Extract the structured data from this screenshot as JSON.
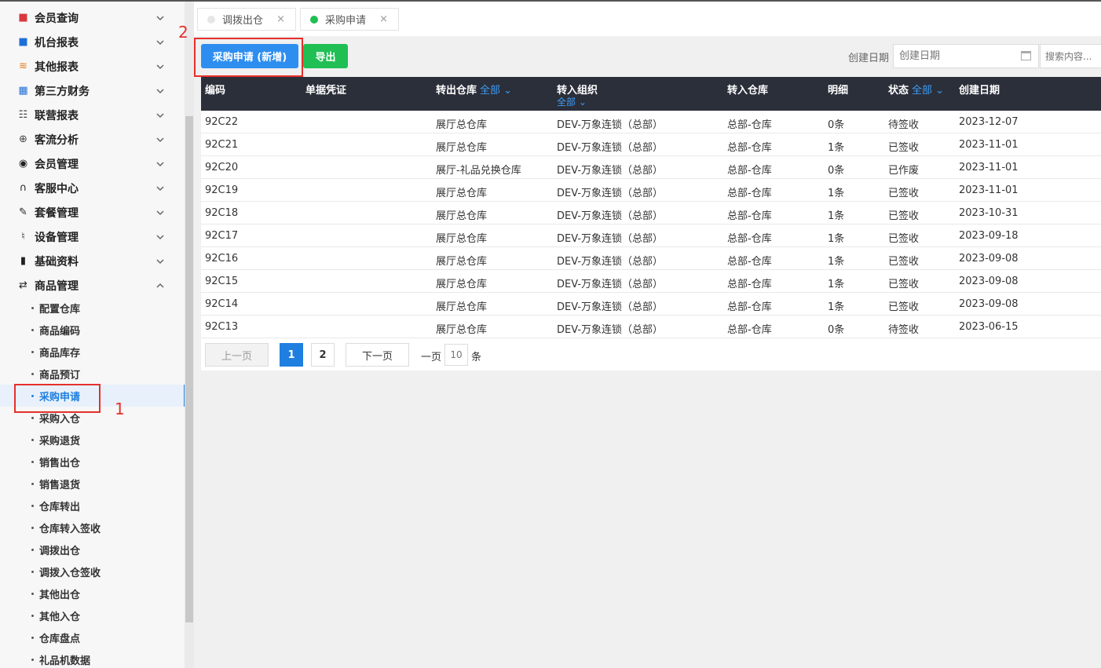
{
  "sidebar": {
    "menu": [
      {
        "label": "会员查询",
        "icon": "book-icon",
        "glyph": "■",
        "color": "#d9363e",
        "expanded": false
      },
      {
        "label": "机台报表",
        "icon": "book-blue-icon",
        "glyph": "■",
        "color": "#1e6fd9",
        "expanded": false
      },
      {
        "label": "其他报表",
        "icon": "layers-icon",
        "glyph": "≋",
        "color": "#e07b1e",
        "expanded": false
      },
      {
        "label": "第三方财务",
        "icon": "calculator-icon",
        "glyph": "▦",
        "color": "#1e6fd9",
        "expanded": false
      },
      {
        "label": "联营报表",
        "icon": "users-icon",
        "glyph": "☷",
        "color": "#444",
        "expanded": false
      },
      {
        "label": "客流分析",
        "icon": "target-icon",
        "glyph": "⊕",
        "color": "#444",
        "expanded": false
      },
      {
        "label": "会员管理",
        "icon": "user-circle-icon",
        "glyph": "◉",
        "color": "#222",
        "expanded": false
      },
      {
        "label": "客服中心",
        "icon": "headset-icon",
        "glyph": "∩",
        "color": "#222",
        "expanded": false
      },
      {
        "label": "套餐管理",
        "icon": "edit-icon",
        "glyph": "✎",
        "color": "#222",
        "expanded": false
      },
      {
        "label": "设备管理",
        "icon": "stethoscope-icon",
        "glyph": "♮",
        "color": "#222",
        "expanded": false
      },
      {
        "label": "基础资料",
        "icon": "file-icon",
        "glyph": "▮",
        "color": "#222",
        "expanded": false
      },
      {
        "label": "商品管理",
        "icon": "transfer-icon",
        "glyph": "⇄",
        "color": "#222",
        "expanded": true
      }
    ],
    "submenu": [
      {
        "label": "配置仓库"
      },
      {
        "label": "商品编码"
      },
      {
        "label": "商品库存"
      },
      {
        "label": "商品预订"
      },
      {
        "label": "采购申请",
        "active": true
      },
      {
        "label": "采购入仓"
      },
      {
        "label": "采购退货"
      },
      {
        "label": "销售出仓"
      },
      {
        "label": "销售退货"
      },
      {
        "label": "仓库转出"
      },
      {
        "label": "仓库转入签收"
      },
      {
        "label": "调拨出仓"
      },
      {
        "label": "调拨入仓签收"
      },
      {
        "label": "其他出仓"
      },
      {
        "label": "其他入仓"
      },
      {
        "label": "仓库盘点"
      },
      {
        "label": "礼品机数据"
      }
    ]
  },
  "tabs": [
    {
      "label": "调拨出仓",
      "dot_color": "#e6e6e6",
      "close": "×"
    },
    {
      "label": "采购申请",
      "dot_color": "#1fbf54",
      "close": "×"
    }
  ],
  "toolbar": {
    "add_label": "采购申请 (新增)",
    "export_label": "导出",
    "date_filter_label": "创建日期",
    "date_placeholder": "创建日期",
    "search_placeholder": "搜索内容..."
  },
  "table": {
    "columns": [
      {
        "label": "编码"
      },
      {
        "label": "单据凭证"
      },
      {
        "label": "转出仓库",
        "filter": "全部 ⌄"
      },
      {
        "label": "转入组织",
        "filter2": "全部 ⌄"
      },
      {
        "label": "转入仓库"
      },
      {
        "label": "明细"
      },
      {
        "label": "状态",
        "filter": "全部 ⌄"
      },
      {
        "label": "创建日期"
      }
    ],
    "rows": [
      [
        "92C22",
        "",
        "展厅总仓库",
        "DEV-万象连锁（总部）",
        "总部-仓库",
        "0条",
        "待签收",
        "2023-12-07"
      ],
      [
        "92C21",
        "",
        "展厅总仓库",
        "DEV-万象连锁（总部）",
        "总部-仓库",
        "1条",
        "已签收",
        "2023-11-01"
      ],
      [
        "92C20",
        "",
        "展厅-礼品兑换仓库",
        "DEV-万象连锁（总部）",
        "总部-仓库",
        "0条",
        "已作废",
        "2023-11-01"
      ],
      [
        "92C19",
        "",
        "展厅总仓库",
        "DEV-万象连锁（总部）",
        "总部-仓库",
        "1条",
        "已签收",
        "2023-11-01"
      ],
      [
        "92C18",
        "",
        "展厅总仓库",
        "DEV-万象连锁（总部）",
        "总部-仓库",
        "1条",
        "已签收",
        "2023-10-31"
      ],
      [
        "92C17",
        "",
        "展厅总仓库",
        "DEV-万象连锁（总部）",
        "总部-仓库",
        "1条",
        "已签收",
        "2023-09-18"
      ],
      [
        "92C16",
        "",
        "展厅总仓库",
        "DEV-万象连锁（总部）",
        "总部-仓库",
        "1条",
        "已签收",
        "2023-09-08"
      ],
      [
        "92C15",
        "",
        "展厅总仓库",
        "DEV-万象连锁（总部）",
        "总部-仓库",
        "1条",
        "已签收",
        "2023-09-08"
      ],
      [
        "92C14",
        "",
        "展厅总仓库",
        "DEV-万象连锁（总部）",
        "总部-仓库",
        "1条",
        "已签收",
        "2023-09-08"
      ],
      [
        "92C13",
        "",
        "展厅总仓库",
        "DEV-万象连锁（总部）",
        "总部-仓库",
        "0条",
        "待签收",
        "2023-06-15"
      ]
    ]
  },
  "pagination": {
    "prev": "上一页",
    "pages": [
      "1",
      "2"
    ],
    "current": "1",
    "next": "下一页",
    "per_page_prefix": "一页",
    "per_page_value": "10",
    "per_page_suffix": "条"
  },
  "annotations": {
    "marker1": "1",
    "marker2": "2",
    "color": "#e5302b"
  }
}
